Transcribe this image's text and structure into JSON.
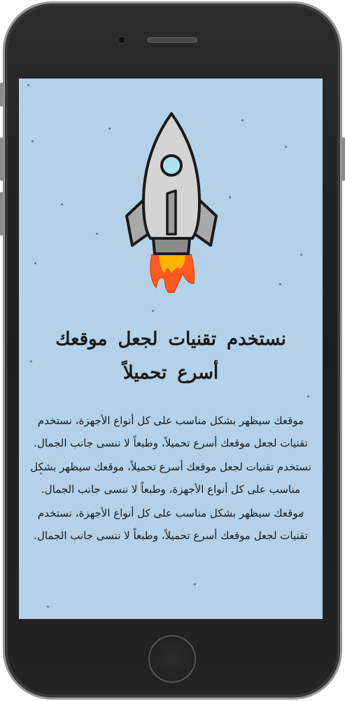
{
  "hero": {
    "icon": "rocket-icon",
    "colors": {
      "background": "#b3d1e8",
      "rocket_body": "#d4d4d4",
      "window": "#aee3ef",
      "flame_outer": "#ff5a1f",
      "flame_inner": "#ffb400"
    }
  },
  "content": {
    "headline": "نستخدم تقنيات لجعل موقعك أسرع تحميلاً",
    "paragraphs": [
      "موقعك سيظهر بشكل مناسب على كل أنواع الأجهزة، نستخدم تقنيات لجعل موقعك أسرع تحميلاً، وطبعاً لا ننسى جانب الجمال.",
      "نستخدم تقنيات لجعل موقعك أسرع تحميلاً، موقعك سيظهر بشكل مناسب على كل أنواع الأجهزة، وطبعاً لا ننسى جانب الجمال.",
      "موقعك سيظهر بشكل مناسب على كل أنواع الأجهزة، نستخدم تقنيات لجعل موقعك أسرع تحميلاً، وطبعاً لا ننسى جانب الجمال."
    ]
  }
}
